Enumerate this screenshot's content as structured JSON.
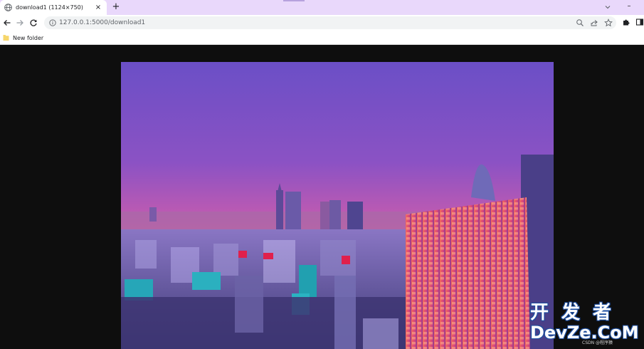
{
  "tab": {
    "title": "download1 (1124×750)",
    "close_label": "×",
    "new_tab_label": "+"
  },
  "window": {
    "minimize_label": "–"
  },
  "toolbar": {
    "url": "127.0.0.1:5000/download1"
  },
  "bookmarks": {
    "items": [
      {
        "label": "New folder"
      }
    ]
  },
  "watermark": {
    "cn": "开发者",
    "en": "DevZe.CoM",
    "source": "CSDN @程序猿"
  },
  "colors": {
    "tab_strip": "#e9d8fb",
    "viewer_background": "#0e0e0e",
    "omnibox": "#f1f3f4",
    "folder": "#f6d66b"
  }
}
